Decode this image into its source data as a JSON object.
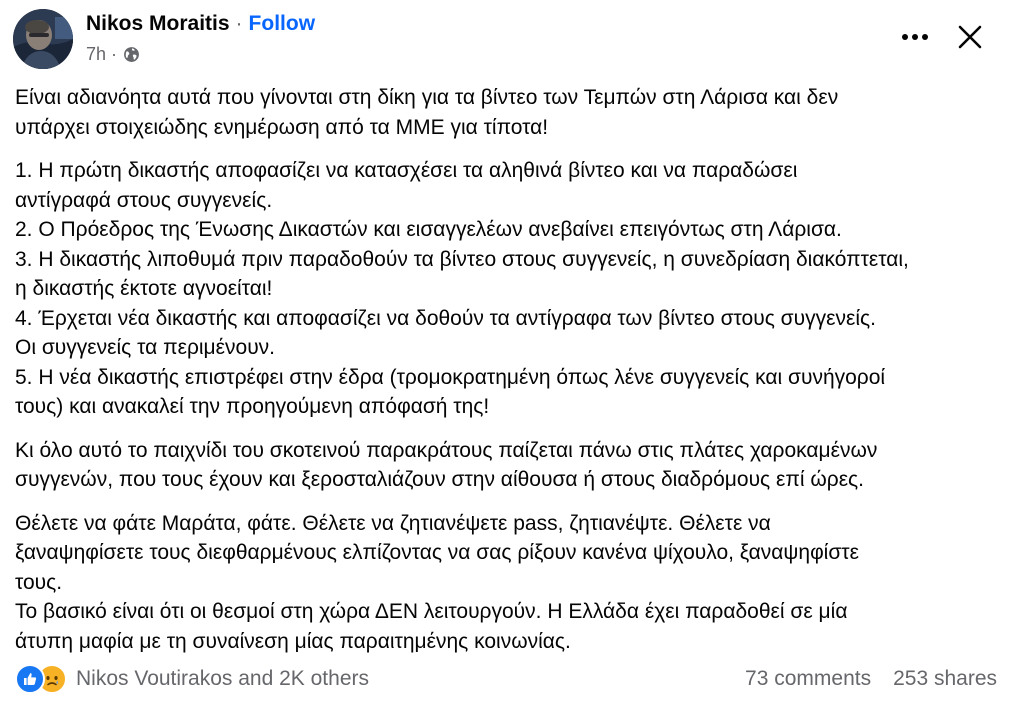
{
  "header": {
    "author_name": "Nikos Moraitis",
    "separator": "·",
    "follow_label": "Follow",
    "time": "7h",
    "meta_separator": "·",
    "privacy_icon": "globe-icon",
    "more_icon": "more-options-icon",
    "close_icon": "close-icon"
  },
  "post": {
    "paragraphs": [
      "Είναι αδιανόητα αυτά που γίνονται στη δίκη για τα βίντεο των Τεμπών στη Λάρισα και δεν\nυπάρχει στοιχειώδης ενημέρωση από τα ΜΜΕ για τίποτα!",
      "1. Η πρώτη δικαστής αποφασίζει να κατασχέσει τα αληθινά βίντεο και να παραδώσει\nαντίγραφά στους συγγενείς.\n2. Ο Πρόεδρος της Ένωσης Δικαστών και εισαγγελέων ανεβαίνει επειγόντως στη Λάρισα.\n3. Η δικαστής λιποθυμά πριν παραδοθούν τα βίντεο στους συγγενείς, η συνεδρίαση διακόπτεται,\nη δικαστής έκτοτε αγνοείται!\n4. Έρχεται νέα δικαστής και αποφασίζει να δοθούν τα αντίγραφα των βίντεο στους συγγενείς.\nΟι συγγενείς τα περιμένουν.\n5. Η νέα δικαστής επιστρέφει στην έδρα (τρομοκρατημένη όπως λένε συγγενείς και συνήγοροί\nτους) και ανακαλεί την προηγούμενη απόφασή της!",
      "Κι όλο αυτό το παιχνίδι του σκοτεινού παρακράτους παίζεται πάνω στις πλάτες χαροκαμένων\nσυγγενών, που τους έχουν και ξεροσταλιάζουν στην αίθουσα ή στους διαδρόμους επί ώρες.",
      "Θέλετε να φάτε Μαράτα, φάτε. Θέλετε να ζητιανέψετε pass, ζητιανέψτε. Θέλετε να\nξαναψηφίσετε τους διεφθαρμένους ελπίζοντας να σας ρίξουν κανένα ψίχουλο, ξαναψηφίστε\nτους.\nΤο βασικό είναι ότι οι θεσμοί στη χώρα ΔΕΝ λειτουργούν. Η Ελλάδα έχει παραδοθεί σε μία\nάτυπη μαφία με τη συναίνεση μίας παραιτημένης κοινωνίας."
    ]
  },
  "footer": {
    "reactions": [
      "like-reaction-icon",
      "sad-reaction-icon"
    ],
    "reactors_text": "Nikos Voutirakos and 2K others",
    "comments": "73 comments",
    "shares": "253 shares"
  },
  "colors": {
    "text": "#050505",
    "secondary": "#65676b",
    "link": "#0866ff",
    "like_blue": "#1877f2",
    "sad_yellow": "#f7b125"
  }
}
